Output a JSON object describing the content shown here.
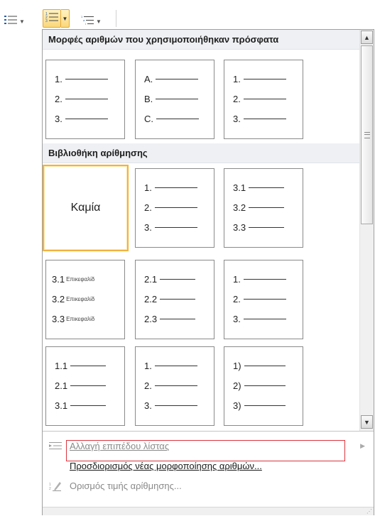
{
  "toolbar": {
    "buttons": [
      {
        "name": "bullets",
        "icon": "bullet-list-icon"
      },
      {
        "name": "numbering",
        "icon": "numbered-list-icon",
        "active": true
      },
      {
        "name": "multilevel-list",
        "icon": "multilevel-list-icon"
      }
    ]
  },
  "sections": {
    "recent": "Μορφές αριθμών που χρησιμοποιήθηκαν πρόσφατα",
    "library": "Βιβλιοθήκη αρίθμησης"
  },
  "tiles": {
    "recent": [
      {
        "rows": [
          "1.",
          "2.",
          "3."
        ]
      },
      {
        "rows": [
          "A.",
          "B.",
          "C."
        ]
      },
      {
        "rows": [
          "1.",
          "2.",
          "3."
        ]
      }
    ],
    "library": [
      {
        "none_label": "Καμία"
      },
      {
        "rows": [
          "1.",
          "2.",
          "3."
        ]
      },
      {
        "rows": [
          "3.1",
          "3.2",
          "3.3"
        ]
      },
      {
        "rows": [
          "3.1",
          "3.2",
          "3.3"
        ],
        "heading": "Επικεφαλίδ"
      },
      {
        "rows": [
          "2.1",
          "2.2",
          "2.3"
        ]
      },
      {
        "rows": [
          "1.",
          "2.",
          "3."
        ]
      },
      {
        "rows": [
          "1.1",
          "2.1",
          "3.1"
        ]
      },
      {
        "rows": [
          "1.",
          "2.",
          "3."
        ]
      },
      {
        "rows": [
          "1)",
          "2)",
          "3)"
        ]
      }
    ]
  },
  "menu": {
    "change_level": "Αλλαγή επιπέδου λίστας",
    "define_new_format": "Προσδιορισμός νέας μορφοποίησης αριθμών...",
    "set_value": "Ορισμός τιμής αρίθμησης..."
  },
  "colors": {
    "selected_border": "#f2b33d",
    "highlight_box": "#d9363e",
    "section_bg": "#eef0f3"
  }
}
